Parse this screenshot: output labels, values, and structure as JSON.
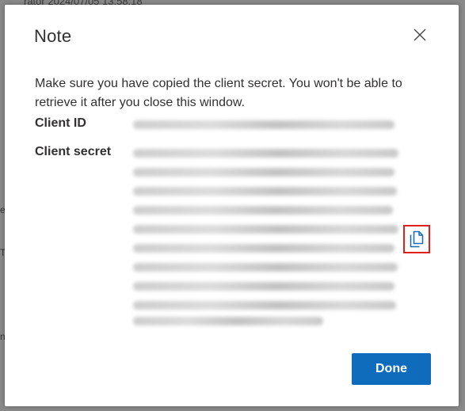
{
  "background": {
    "top_text": "rator          2024/07/05 13:58:18",
    "left_chars": [
      "e",
      "T",
      "n"
    ]
  },
  "dialog": {
    "title": "Note",
    "message": "Make sure you have copied the client secret. You won't be able to retrieve it after you close this window.",
    "client_id_label": "Client ID",
    "client_secret_label": "Client secret",
    "done_label": "Done"
  },
  "icons": {
    "close": "close-icon",
    "copy": "copy-icon"
  },
  "colors": {
    "primary": "#0f6cbd",
    "highlight": "#e0201b",
    "text": "#323130"
  }
}
